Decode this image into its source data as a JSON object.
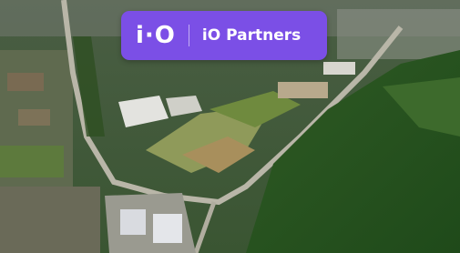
{
  "badge": {
    "logo_mark": "i·O",
    "brand_name": "iO Partners",
    "color": "#7b4fe6"
  }
}
